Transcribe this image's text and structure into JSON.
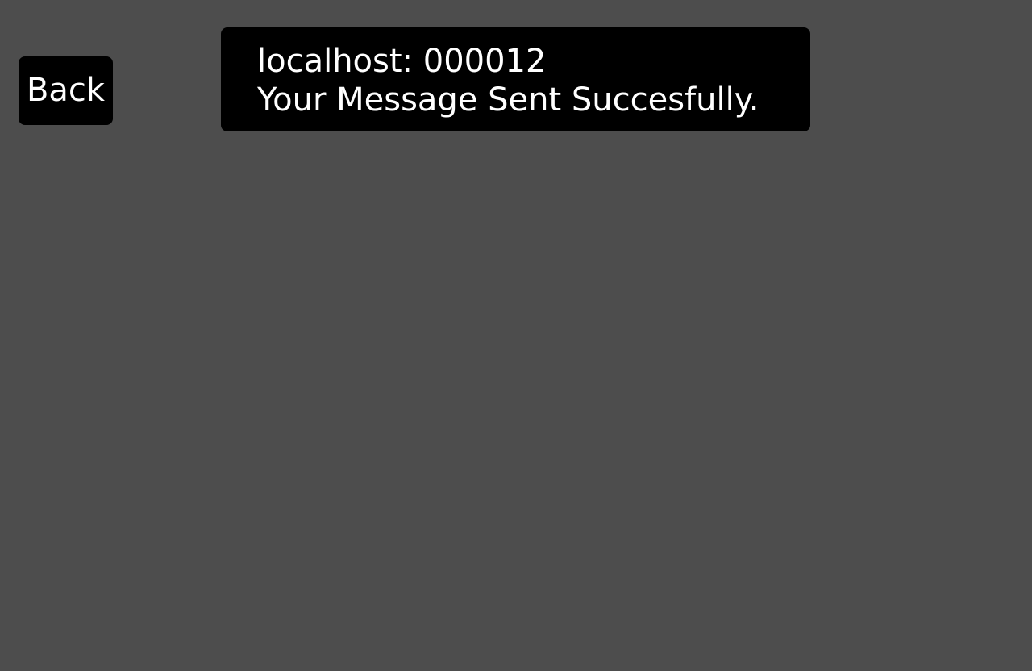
{
  "back_button": {
    "label": "Back"
  },
  "alert": {
    "origin": "localhost: 000012",
    "message": "Your Message Sent Succesfully."
  },
  "colors": {
    "page_background": "#4d4d4d",
    "button_background": "#000000",
    "alert_background": "#000000",
    "text": "#ffffff"
  }
}
